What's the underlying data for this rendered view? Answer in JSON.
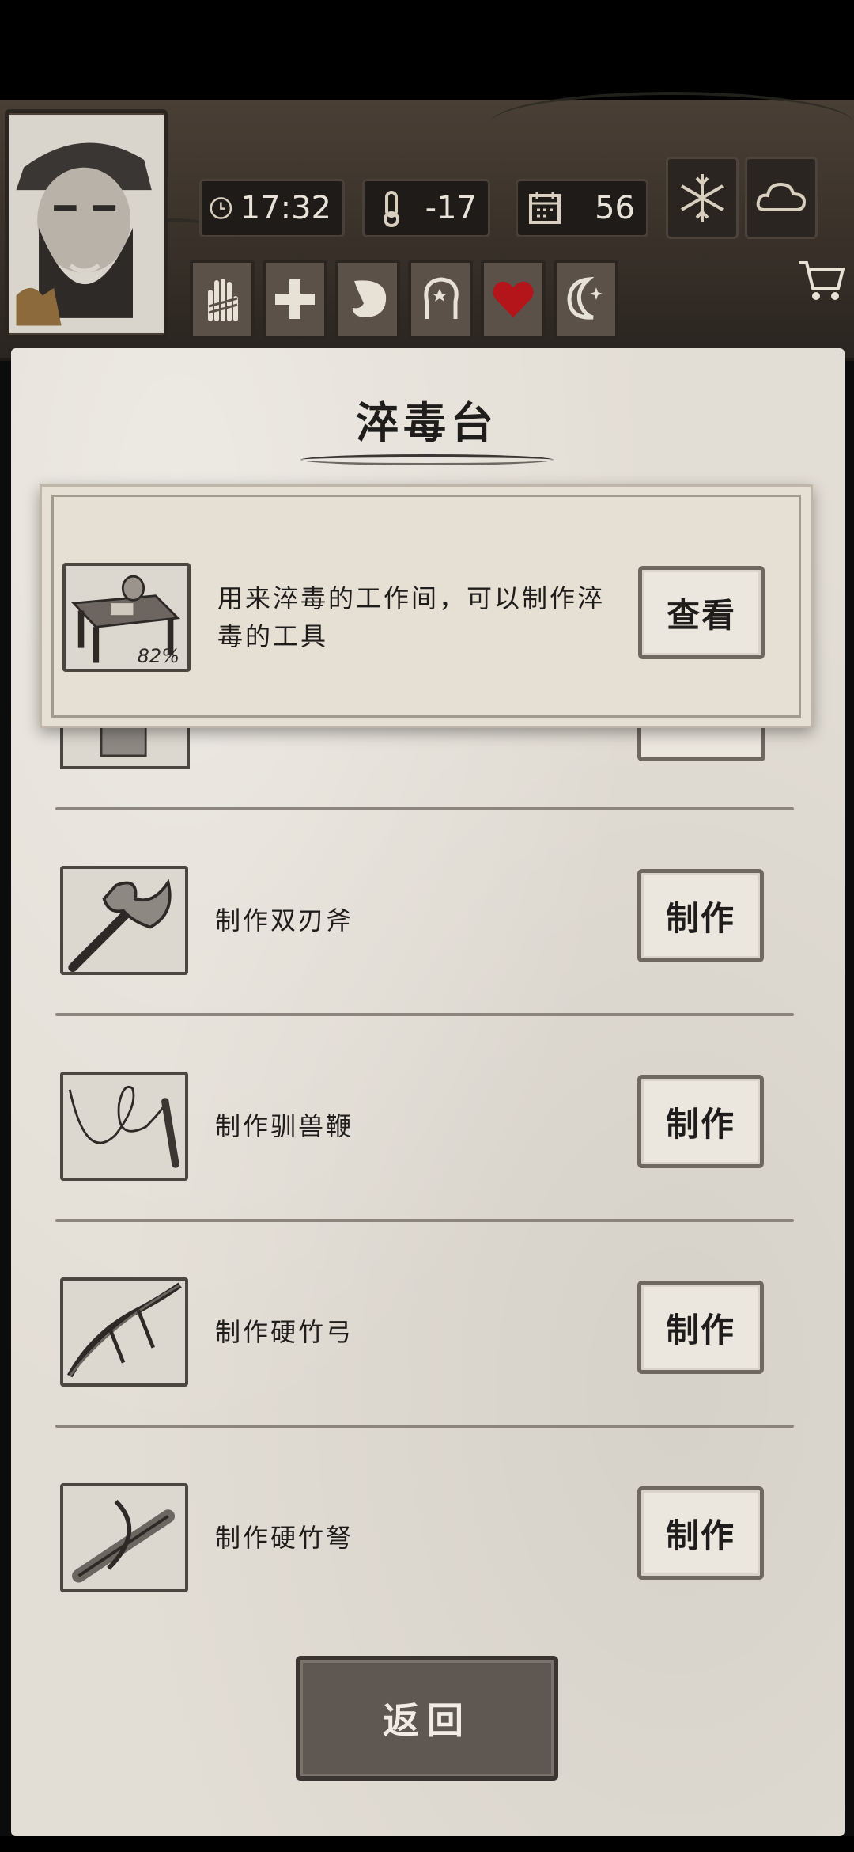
{
  "hud": {
    "time": "17:32",
    "temperature": "-17",
    "day": "56",
    "weather": [
      "snowflake-icon",
      "cloud-icon"
    ],
    "tabs": [
      "bandaged-hand-icon",
      "medical-cross-icon",
      "stomach-icon",
      "head-mind-icon",
      "heart-icon",
      "moon-star-icon"
    ],
    "heart_color": "#b3151b"
  },
  "panel": {
    "title": "淬毒台",
    "popup": {
      "description": "用来淬毒的工作间，可以制作淬毒的工具",
      "progress": "82%",
      "view_label": "查看"
    },
    "recipes": [
      {
        "label": "制作双刃斧",
        "button": "制作",
        "icon": "double-axe-icon"
      },
      {
        "label": "制作驯兽鞭",
        "button": "制作",
        "icon": "whip-icon"
      },
      {
        "label": "制作硬竹弓",
        "button": "制作",
        "icon": "bamboo-bow-icon"
      },
      {
        "label": "制作硬竹弩",
        "button": "制作",
        "icon": "bamboo-crossbow-icon"
      }
    ],
    "back_label": "返回"
  }
}
